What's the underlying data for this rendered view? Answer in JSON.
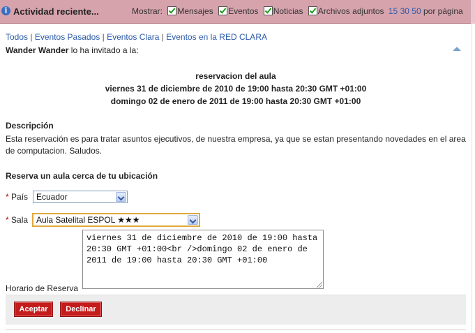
{
  "header": {
    "title": "Actividad reciente...",
    "show_label": "Mostrar:",
    "filters": [
      "Mensajes",
      "Eventos",
      "Noticias",
      "Archivos adjuntos"
    ],
    "page_sizes": [
      "15",
      "30",
      "50"
    ],
    "per_page_label": "por página"
  },
  "links": [
    "Todos",
    "Eventos Pasados",
    "Eventos Clara",
    "Eventos en la RED CLARA"
  ],
  "invite": {
    "name": "Wander Wander",
    "text": "lo ha invitado a la:"
  },
  "event": {
    "title": "reservacion del aula",
    "line1": "viernes 31 de diciembre de 2010 de 19:00 hasta 20:30 GMT +01:00",
    "line2": "domingo 02 de enero de 2011 de 19:00 hasta 20:30 GMT +01:00"
  },
  "description": {
    "title": "Descripción",
    "text": "Esta reservación es para tratar asuntos ejecutivos, de nuestra empresa, ya que se estan presentando novedades en el area de computacion. Saludos."
  },
  "reserve": {
    "title": "Reserva un aula cerca de tu ubicación",
    "required_mark": "*",
    "country_label": "País",
    "country_value": "Ecuador",
    "room_label": "Sala",
    "room_value": "Aula Satelital ESPOL ★★★",
    "schedule_label": "Horario de Reserva",
    "schedule_value": "viernes 31 de diciembre de 2010 de 19:00 hasta 20:30 GMT +01:00<br />domingo 02 de enero de 2011 de 19:00 hasta 20:30 GMT +01:00"
  },
  "buttons": {
    "accept": "Aceptar",
    "decline": "Declinar"
  },
  "colors": {
    "header_bg": "#d6a3ad",
    "button_red": "#c41c1c",
    "link": "#2a5aa8",
    "focus": "#e0a83c"
  }
}
